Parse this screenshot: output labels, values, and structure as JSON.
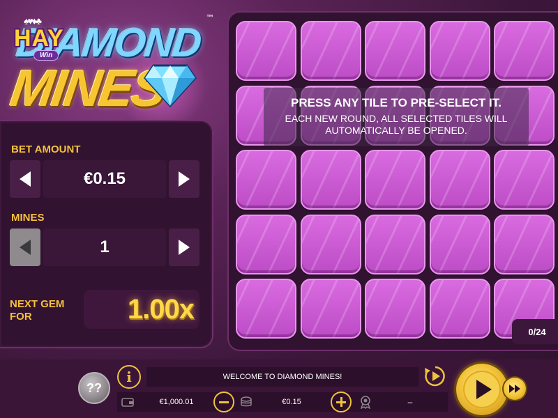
{
  "brand": {
    "hay_text": "HAY",
    "win_text": "Win",
    "cards_glyphs": "♠♥♦♣"
  },
  "logo": {
    "title_line1": "DIAMOND",
    "title_line2": "MINES",
    "trademark": "™"
  },
  "left_panel": {
    "bet_label": "BET AMOUNT",
    "bet_value": "€0.15",
    "mines_label": "MINES",
    "mines_value": "1",
    "next_gem_label": "NEXT GEM FOR",
    "multiplier": "1.00x"
  },
  "grid": {
    "rows": 5,
    "cols": 5,
    "info_title": "PRESS ANY TILE TO PRE-SELECT IT.",
    "info_body": "EACH NEW ROUND, ALL SELECTED TILES WILL AUTOMATICALLY BE OPENED.",
    "counter": "0/24"
  },
  "bottom_bar": {
    "help_glyph": "??",
    "info_glyph": "i",
    "message": "WELCOME TO DIAMOND MINES!",
    "balance": "€1,000.01",
    "bet": "€0.15",
    "win": "–"
  },
  "colors": {
    "accent_gold": "#f0c43a",
    "tile_pink": "#d96be0",
    "panel_bg": "#311230",
    "label_gold": "#f5c13c"
  },
  "icons": [
    "help-icon",
    "info-icon",
    "autoplay-icon",
    "wallet-icon",
    "minus-icon",
    "coins-icon",
    "plus-icon",
    "win-icon",
    "play-icon",
    "turbo-icon",
    "arrow-left-icon",
    "arrow-right-icon",
    "diamond-icon"
  ]
}
